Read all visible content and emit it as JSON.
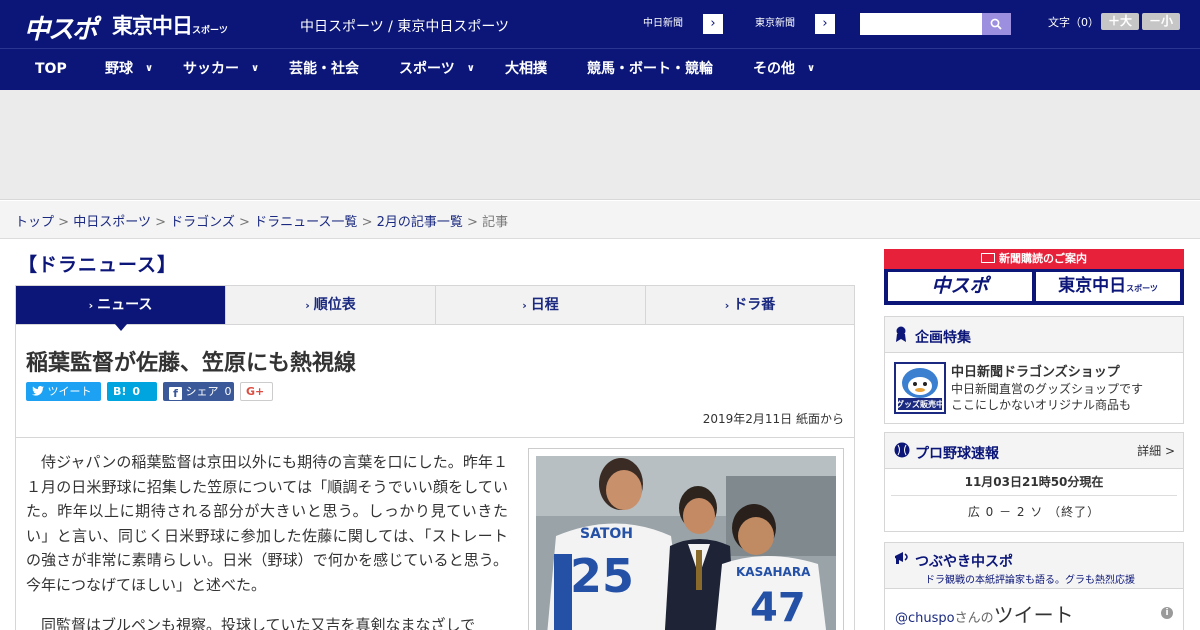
{
  "header": {
    "logo_main": "中スポ",
    "logo_tokyo": "東京中日",
    "logo_tokyo_suffix": "スポーツ",
    "site_name": "中日スポーツ / 東京中日スポーツ",
    "paper_links": [
      {
        "label": "中日新聞",
        "arrow": "›"
      },
      {
        "label": "東京新聞",
        "arrow": "›"
      }
    ],
    "font_size_label": "文字（0）",
    "font_larger": "＋大",
    "font_smaller": "－小"
  },
  "nav": {
    "items": [
      {
        "label": "TOP",
        "has_menu": false
      },
      {
        "label": "野球",
        "has_menu": true
      },
      {
        "label": "サッカー",
        "has_menu": true
      },
      {
        "label": "芸能・社会",
        "has_menu": false
      },
      {
        "label": "スポーツ",
        "has_menu": true
      },
      {
        "label": "大相撲",
        "has_menu": false
      },
      {
        "label": "競馬・ボート・競輪",
        "has_menu": false
      },
      {
        "label": "その他",
        "has_menu": true
      }
    ],
    "chevron": "∨"
  },
  "breadcrumb": {
    "items": [
      "トップ",
      "中日スポーツ",
      "ドラゴンズ",
      "ドラニュース一覧",
      "2月の記事一覧"
    ],
    "current": "記事",
    "separator": ">"
  },
  "section": {
    "title": "【ドラニュース】"
  },
  "tabs": [
    {
      "label": "ニュース",
      "active": true
    },
    {
      "label": "順位表",
      "active": false
    },
    {
      "label": "日程",
      "active": false
    },
    {
      "label": "ドラ番",
      "active": false
    }
  ],
  "article": {
    "headline": "稲葉監督が佐藤、笠原にも熱視線",
    "share": {
      "tweet": "ツイート",
      "hatena": "B!",
      "hatena_count": "0",
      "facebook": "シェア",
      "facebook_count": "0",
      "gplus": "G+"
    },
    "date": "2019年2月11日 紙面から",
    "paragraphs": [
      "侍ジャパンの稲葉監督は京田以外にも期待の言葉を口にした。昨年１１月の日米野球に招集した笠原については「順調そうでいい顔をしていた。昨年以上に期待される部分が大きいと思う。しっかり見ていきたい」と言い、同じく日米野球に参加した佐藤に関しては、「ストレートの強さが非常に素晴らしい。日米（野球）で何かを感じていると思う。今年につなげてほしい」と述べた。",
      "同監督はブルペンも視察。投球していた又吉を真剣なまなざしで"
    ],
    "photo": {
      "jersey_left_name": "SATOH",
      "jersey_left_number": "25",
      "jersey_right_name": "KASAHARA",
      "jersey_right_number": "47"
    }
  },
  "sidebar": {
    "subscribe": {
      "head": "新聞購読のご案内",
      "logo_left": "中スポ",
      "logo_right": "東京中日",
      "logo_right_suffix": "スポーツ"
    },
    "feature": {
      "title": "企画特集",
      "shop_badge": "グッズ販売中",
      "shop_title": "中日新聞ドラゴンズショップ",
      "shop_desc_1": "中日新聞直営のグッズショップです",
      "shop_desc_2": "ここにしかないオリジナル商品も"
    },
    "scores": {
      "title": "プロ野球速報",
      "detail": "詳細 >",
      "time": "11月03日21時50分現在",
      "game": "広 0 － 2 ソ （終了）"
    },
    "tweets": {
      "title": "つぶやき中スポ",
      "subtitle": "ドラ観戦の本紙評論家も語る。グラも熱烈応援",
      "user": "@chuspo",
      "user_suffix": "さんの",
      "tweet_label": "ツイート",
      "info": "i"
    }
  },
  "colors": {
    "brand_navy": "#0b1678",
    "subscribe_red": "#e8213a",
    "twitter_blue": "#1da1f2",
    "hatena_blue": "#00a4de",
    "facebook_blue": "#3b5998"
  }
}
